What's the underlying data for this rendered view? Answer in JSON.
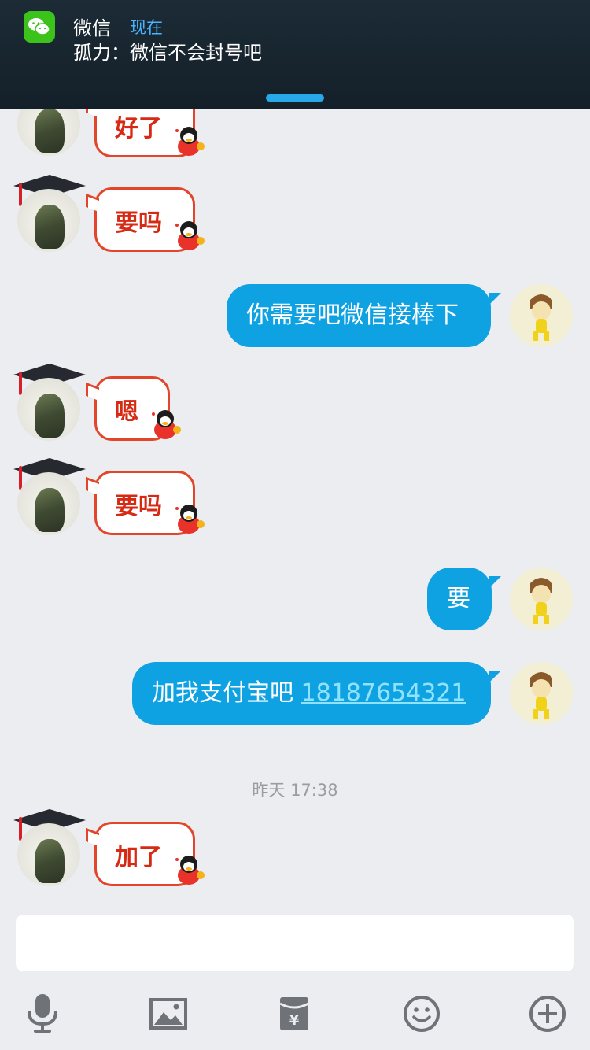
{
  "notification": {
    "app_name": "微信",
    "time": "现在",
    "message": "孤力：微信不会封号吧"
  },
  "messages": [
    {
      "side": "left",
      "type": "sticker",
      "text": "好了"
    },
    {
      "side": "left",
      "type": "sticker",
      "text": "要吗"
    },
    {
      "side": "right",
      "type": "text",
      "text": "你需要吧微信接棒下"
    },
    {
      "side": "left",
      "type": "sticker",
      "text": "嗯"
    },
    {
      "side": "left",
      "type": "sticker",
      "text": "要吗"
    },
    {
      "side": "right",
      "type": "text",
      "text": "要"
    },
    {
      "side": "right",
      "type": "text",
      "text": "加我支付宝吧 ",
      "link": "18187654321"
    },
    {
      "side": "left",
      "type": "sticker",
      "text": "加了"
    }
  ],
  "timestamp": "昨天 17:38",
  "input": {
    "placeholder": ""
  },
  "toolbar": {
    "icons": [
      "microphone-icon",
      "image-icon",
      "red-packet-icon",
      "emoji-icon",
      "plus-icon"
    ]
  },
  "colors": {
    "background": "#ebedf0",
    "bubble_blue": "#0fa2e3",
    "sticker_red": "#d62a14",
    "banner_dark": "#17242e",
    "notif_time_blue": "#4ab4ff"
  }
}
